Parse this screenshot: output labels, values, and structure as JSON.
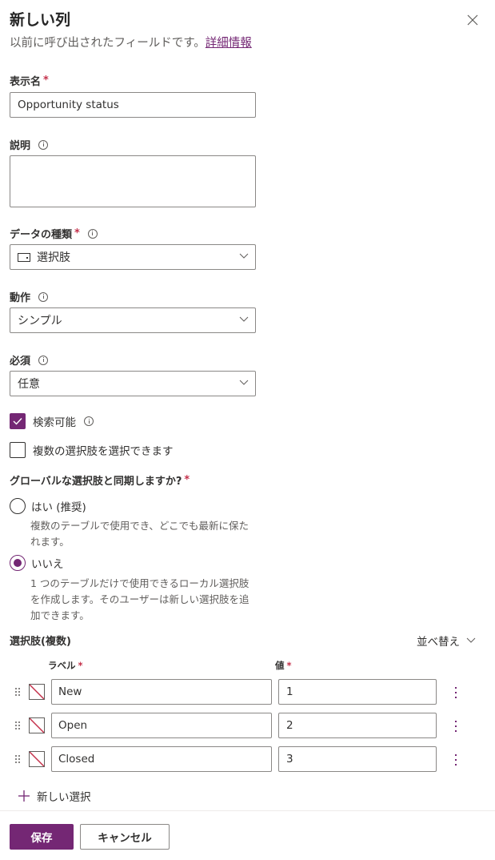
{
  "header": {
    "title": "新しい列",
    "subtitle": "以前に呼び出されたフィールドです。",
    "learn_more_link": "詳細情報",
    "close_icon": "close-icon"
  },
  "fields": {
    "display_name": {
      "label": "表示名",
      "required_marker": "*",
      "value": "Opportunity status"
    },
    "description": {
      "label": "説明",
      "value": ""
    },
    "data_type": {
      "label": "データの種類",
      "required_marker": "*",
      "icon": "choice-icon",
      "selected": "選択肢"
    },
    "behavior": {
      "label": "動作",
      "selected": "シンプル"
    },
    "required": {
      "label": "必須",
      "selected": "任意"
    },
    "searchable": {
      "label": "検索可能",
      "checked": true
    },
    "multi_select": {
      "label": "複数の選択肢を選択できます",
      "checked": false
    }
  },
  "sync_global": {
    "question": "グローバルな選択肢と同期しますか?",
    "required_marker": "*",
    "options": [
      {
        "label": "はい (推奨)",
        "description": "複数のテーブルで使用でき、どこでも最新に保たれます。",
        "selected": false
      },
      {
        "label": "いいえ",
        "description": "1 つのテーブルだけで使用できるローカル選択肢を作成します。そのユーザーは新しい選択肢を追加できます。",
        "selected": true
      }
    ]
  },
  "choices": {
    "section_label": "選択肢(複数)",
    "sort_label": "並べ替え",
    "column_label_header": "ラベル",
    "column_value_header": "値",
    "required_marker": "*",
    "items": [
      {
        "label": "New",
        "value": "1"
      },
      {
        "label": "Open",
        "value": "2"
      },
      {
        "label": "Closed",
        "value": "3"
      }
    ],
    "add_label": "新しい選択"
  },
  "footer": {
    "save_label": "保存",
    "cancel_label": "キャンセル"
  },
  "colors": {
    "accent": "#742774",
    "required": "#c4314b",
    "no_color_slash": "#c4314b"
  }
}
